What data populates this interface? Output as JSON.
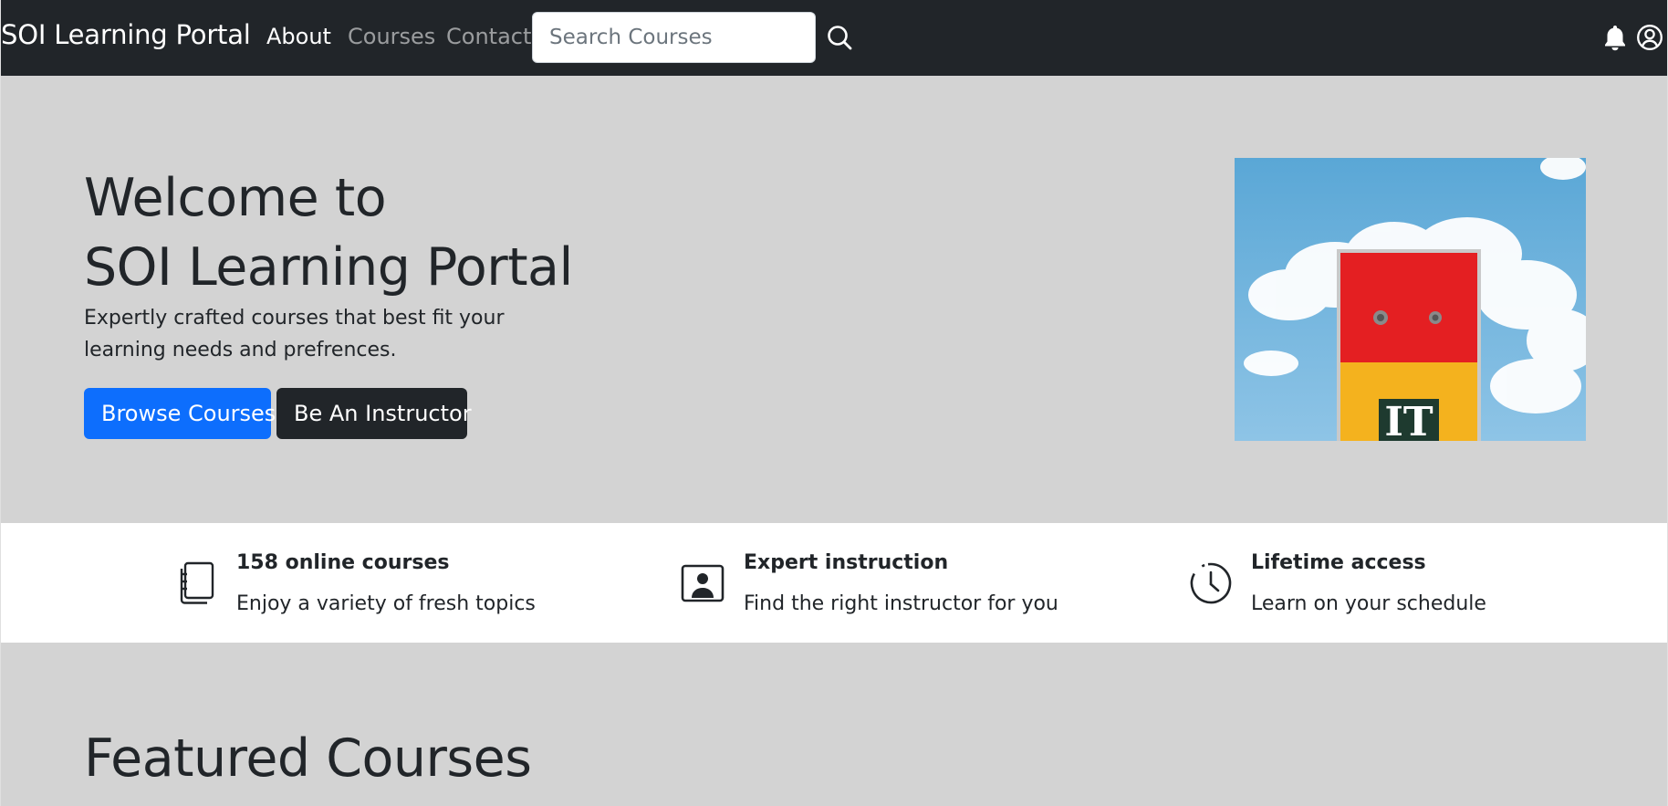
{
  "navbar": {
    "brand": "SOI Learning Portal",
    "links": [
      {
        "label": "About",
        "active": true
      },
      {
        "label": "Courses",
        "active": false
      },
      {
        "label": "Contact",
        "active": false
      }
    ],
    "search": {
      "placeholder": "Search Courses",
      "value": ""
    },
    "icons": {
      "search": "search-icon",
      "notifications": "bell-icon",
      "account": "user-circle-icon"
    }
  },
  "hero": {
    "title_line1": "Welcome to",
    "title_line2": "SOI Learning Portal",
    "subtitle": "Expertly crafted courses that best fit your learning needs and prefrences.",
    "buttons": {
      "browse": "Browse Courses",
      "instructor": "Be An Instructor"
    },
    "image_label": "IT"
  },
  "features": [
    {
      "icon": "journals-icon",
      "title": "158 online courses",
      "description": "Enjoy a variety of fresh topics"
    },
    {
      "icon": "person-video-icon",
      "title": "Expert instruction",
      "description": "Find the right instructor for you"
    },
    {
      "icon": "clock-history-icon",
      "title": "Lifetime access",
      "description": "Learn on your schedule"
    }
  ],
  "featured": {
    "title": "Featured Courses"
  },
  "colors": {
    "navbar_bg": "#212529",
    "hero_bg": "#d3d3d3",
    "primary": "#0d6efd",
    "dark": "#212529"
  }
}
